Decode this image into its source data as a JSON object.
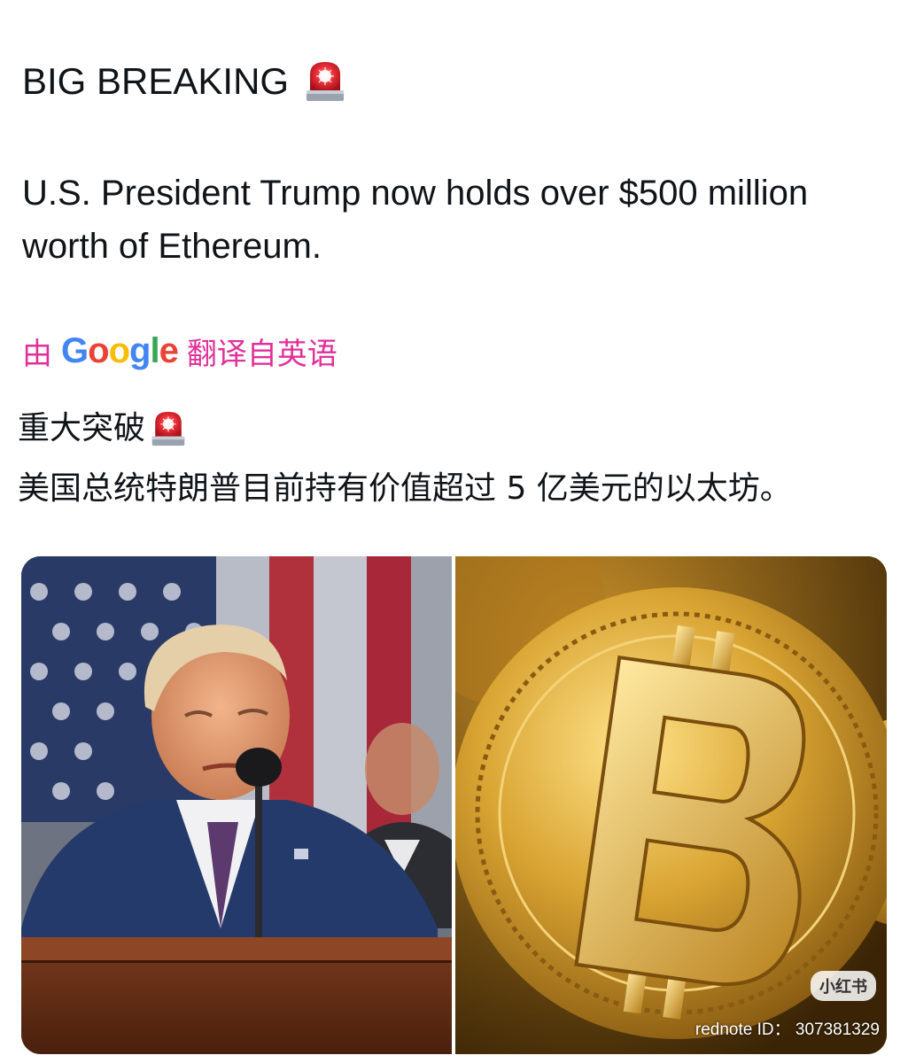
{
  "post": {
    "headline": "BIG BREAKING",
    "body": "U.S. President Trump now holds over $500 million worth of Ethereum.",
    "translation": {
      "prefix": "由",
      "provider": "Google",
      "suffix": "翻译自英语"
    },
    "zh_headline": "重大突破",
    "zh_body": "美国总统特朗普目前持有价值超过 5 亿美元的以太坊。",
    "icons": [
      "siren-icon",
      "siren-icon"
    ]
  },
  "media": {
    "badge": "小红书",
    "watermark": "rednote ID： 307381329"
  },
  "colors": {
    "text": "#0f1419",
    "translation_accent": "#e0309a"
  }
}
